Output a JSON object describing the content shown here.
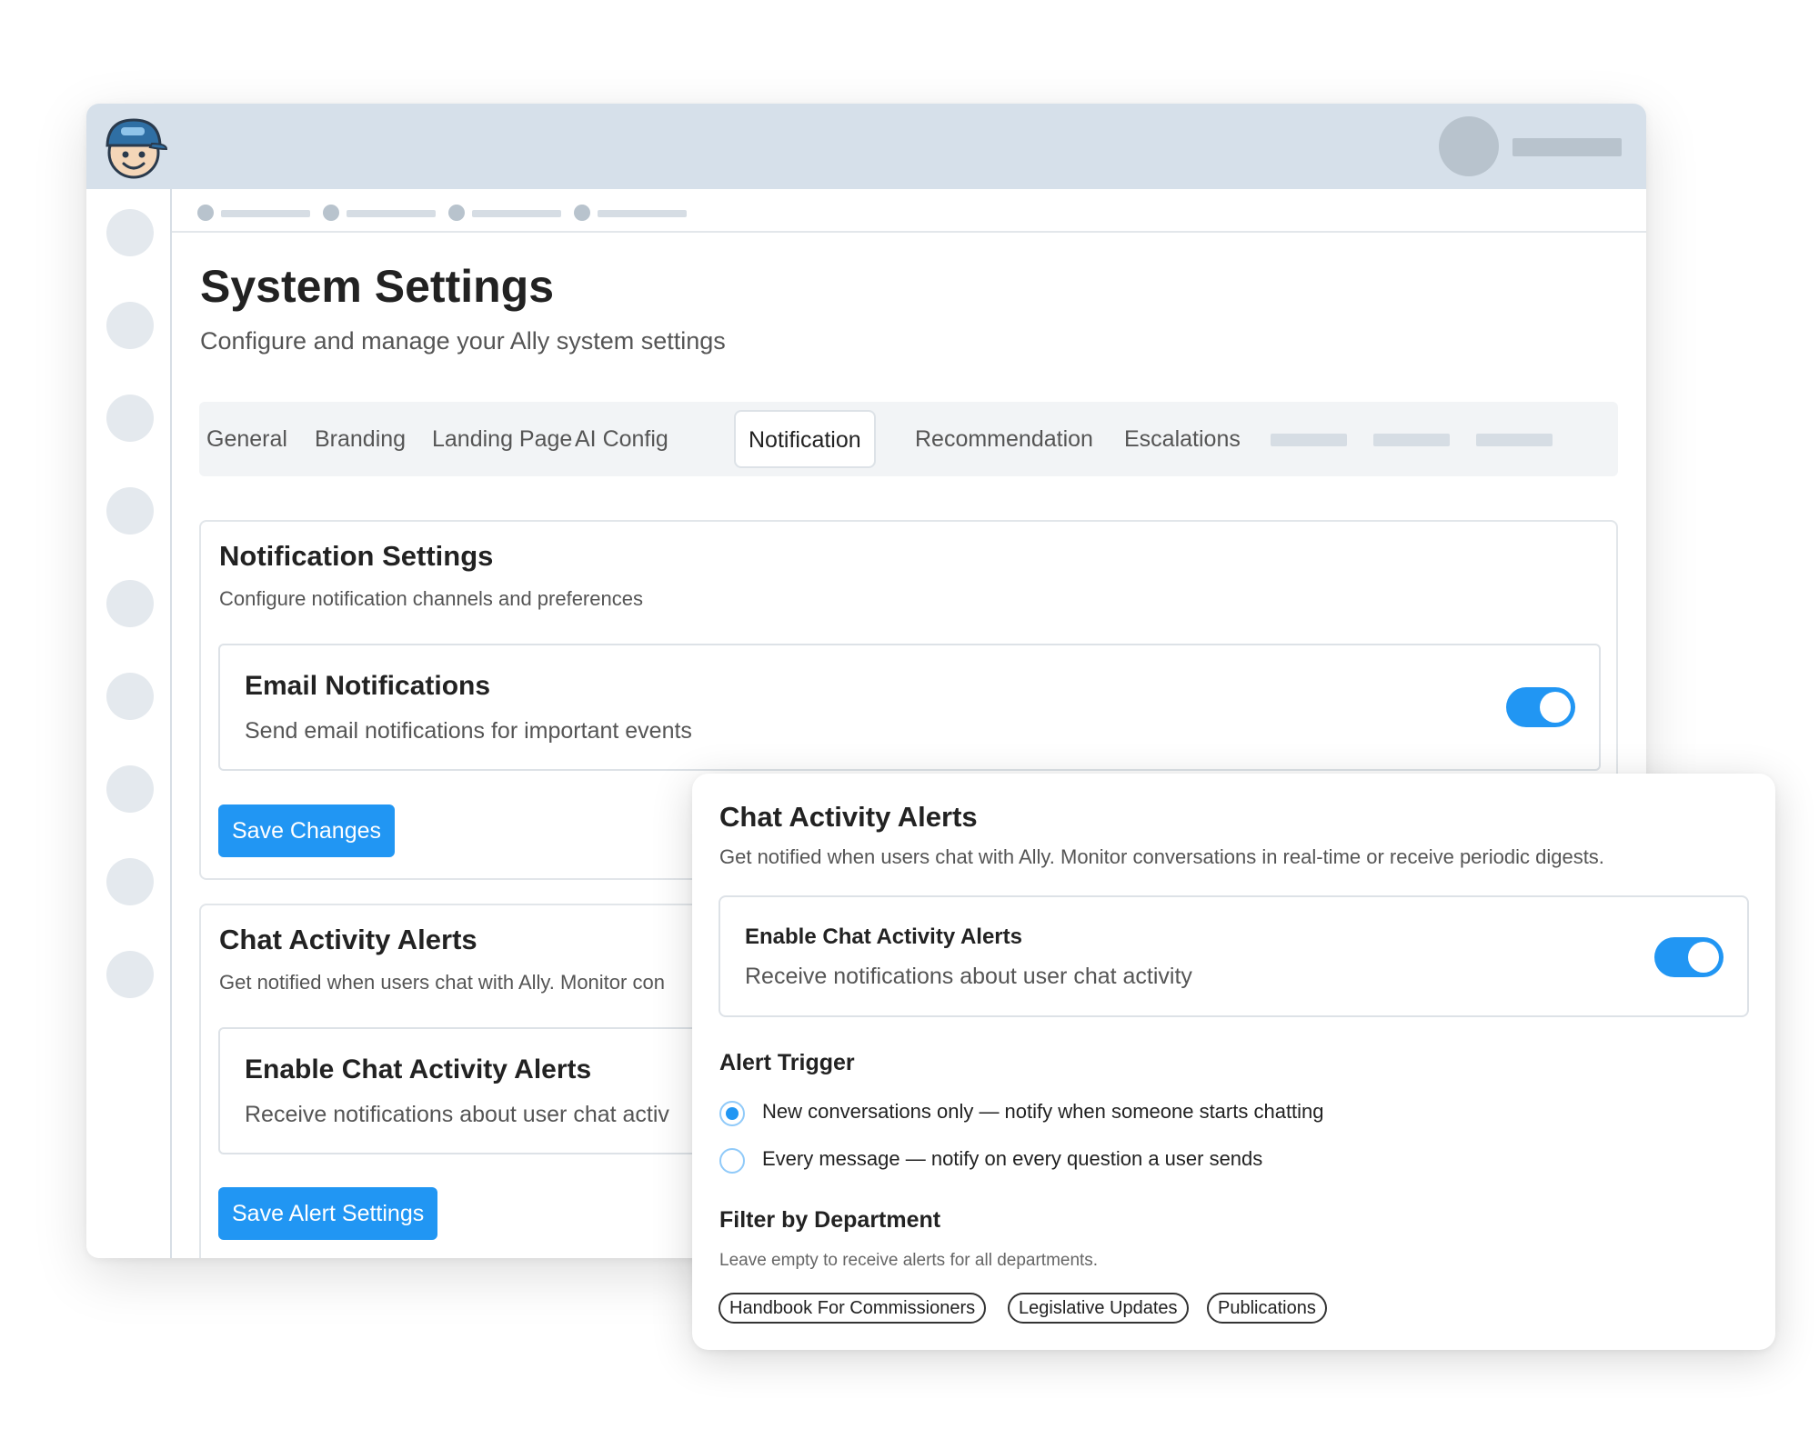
{
  "header": {
    "logo_icon": "mascot-logo-icon"
  },
  "page": {
    "title": "System Settings",
    "subtitle": "Configure and manage your Ally system settings"
  },
  "tabs": [
    {
      "label": "General"
    },
    {
      "label": "Branding"
    },
    {
      "label": "Landing Page"
    },
    {
      "label": "AI Config"
    },
    {
      "label": "Notification",
      "active": true
    },
    {
      "label": "Recommendation"
    },
    {
      "label": "Escalations"
    }
  ],
  "notification_settings": {
    "title": "Notification Settings",
    "subtitle": "Configure notification channels and preferences",
    "email": {
      "title": "Email Notifications",
      "description": "Send email notifications for important events",
      "enabled": true
    },
    "save_label": "Save Changes"
  },
  "chat_alerts_card": {
    "title": "Chat Activity Alerts",
    "subtitle": "Get notified when users chat with Ally. Monitor con",
    "enable_title": "Enable Chat Activity Alerts",
    "enable_description": "Receive notifications about user chat activ",
    "save_label": "Save Alert Settings"
  },
  "popup": {
    "title": "Chat Activity Alerts",
    "subtitle": "Get notified when users chat with Ally. Monitor conversations in real-time or receive periodic digests.",
    "enable": {
      "title": "Enable Chat Activity Alerts",
      "description": "Receive notifications about user chat activity",
      "enabled": true
    },
    "alert_trigger": {
      "label": "Alert Trigger",
      "options": [
        {
          "label": "New conversations only — notify when someone starts chatting",
          "selected": true
        },
        {
          "label": "Every message — notify on every question a user sends",
          "selected": false
        }
      ]
    },
    "filter": {
      "label": "Filter by Department",
      "hint": "Leave empty to receive alerts for all departments.",
      "chips": [
        "Handbook For Commissioners",
        "Legislative Updates",
        "Publications"
      ]
    }
  },
  "colors": {
    "accent": "#2196f3",
    "topbar": "#d6e0ea",
    "placeholder": "#b8c3cd"
  }
}
